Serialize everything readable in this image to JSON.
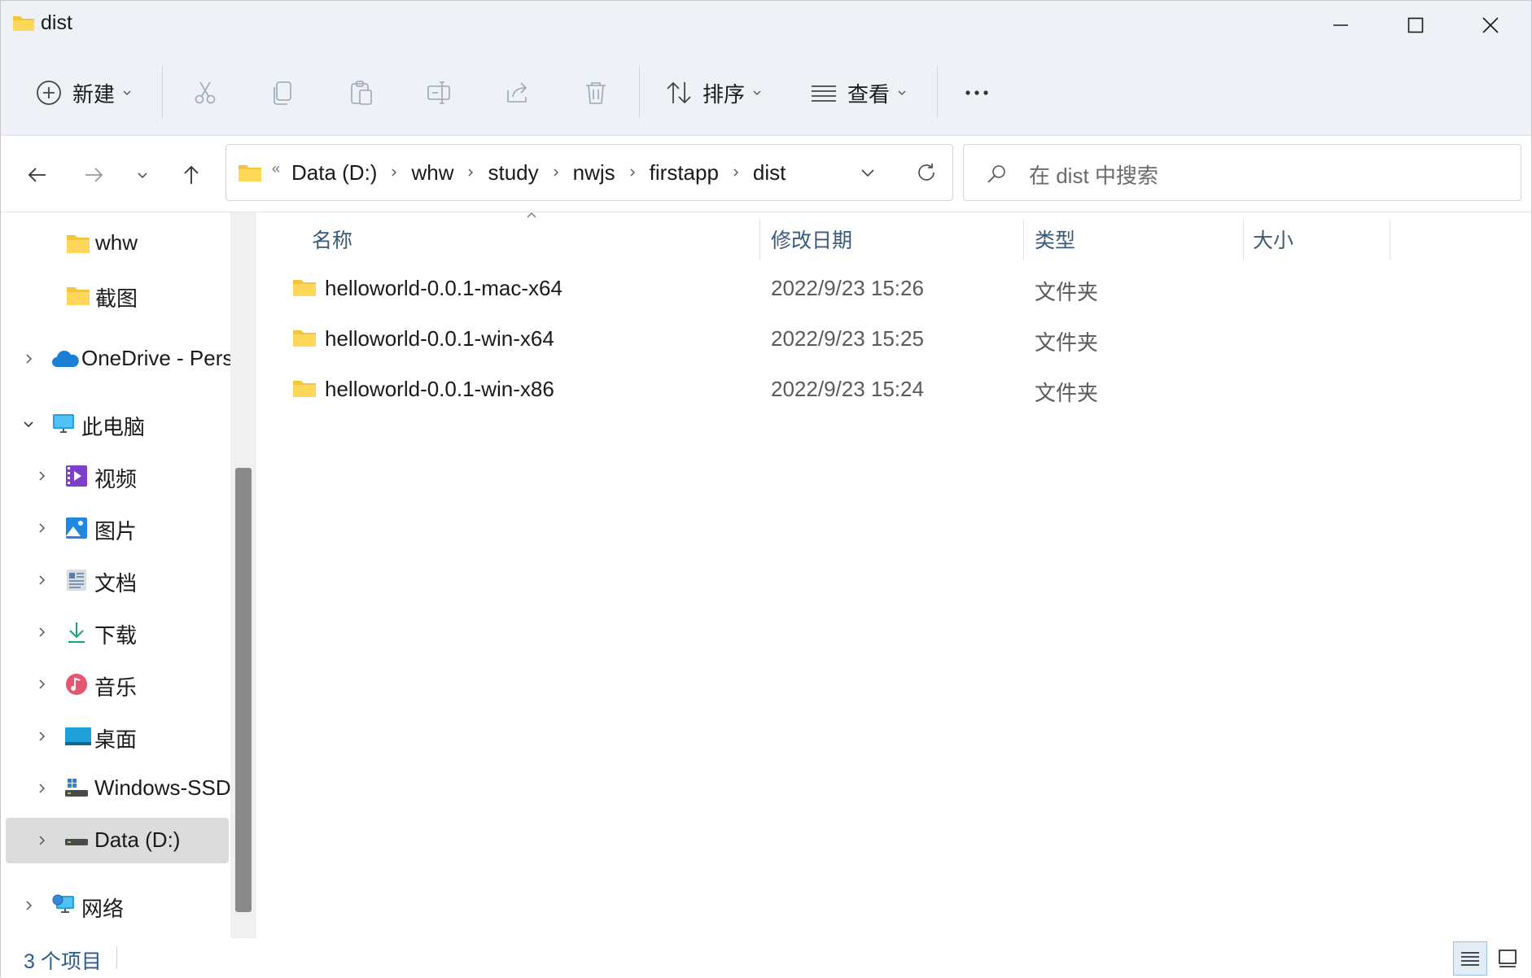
{
  "window": {
    "title": "dist",
    "accent": "#0067c0"
  },
  "commandbar": {
    "new_label": "新建",
    "sort_label": "排序",
    "view_label": "查看",
    "icons": [
      "plus-circle-icon",
      "cut-icon",
      "copy-icon",
      "paste-icon",
      "rename-icon",
      "share-icon",
      "delete-icon",
      "sort-icon",
      "view-icon",
      "more-icon"
    ]
  },
  "address": {
    "crumbs": [
      "Data (D:)",
      "whw",
      "study",
      "nwjs",
      "firstapp",
      "dist"
    ]
  },
  "search": {
    "placeholder": "在 dist 中搜索"
  },
  "sidebar": {
    "items": [
      {
        "label": "whw"
      },
      {
        "label": "截图"
      },
      {
        "label": "OneDrive - Pers"
      },
      {
        "label": "此电脑"
      },
      {
        "label": "视频"
      },
      {
        "label": "图片"
      },
      {
        "label": "文档"
      },
      {
        "label": "下载"
      },
      {
        "label": "音乐"
      },
      {
        "label": "桌面"
      },
      {
        "label": "Windows-SSD"
      },
      {
        "label": "Data (D:)"
      },
      {
        "label": "网络"
      }
    ]
  },
  "list": {
    "columns": {
      "name": "名称",
      "modified": "修改日期",
      "type": "类型",
      "size": "大小"
    },
    "rows": [
      {
        "name": "helloworld-0.0.1-mac-x64",
        "modified": "2022/9/23 15:26",
        "type": "文件夹",
        "size": ""
      },
      {
        "name": "helloworld-0.0.1-win-x64",
        "modified": "2022/9/23 15:25",
        "type": "文件夹",
        "size": ""
      },
      {
        "name": "helloworld-0.0.1-win-x86",
        "modified": "2022/9/23 15:24",
        "type": "文件夹",
        "size": ""
      }
    ]
  },
  "status": {
    "item_count": "3 个项目"
  }
}
